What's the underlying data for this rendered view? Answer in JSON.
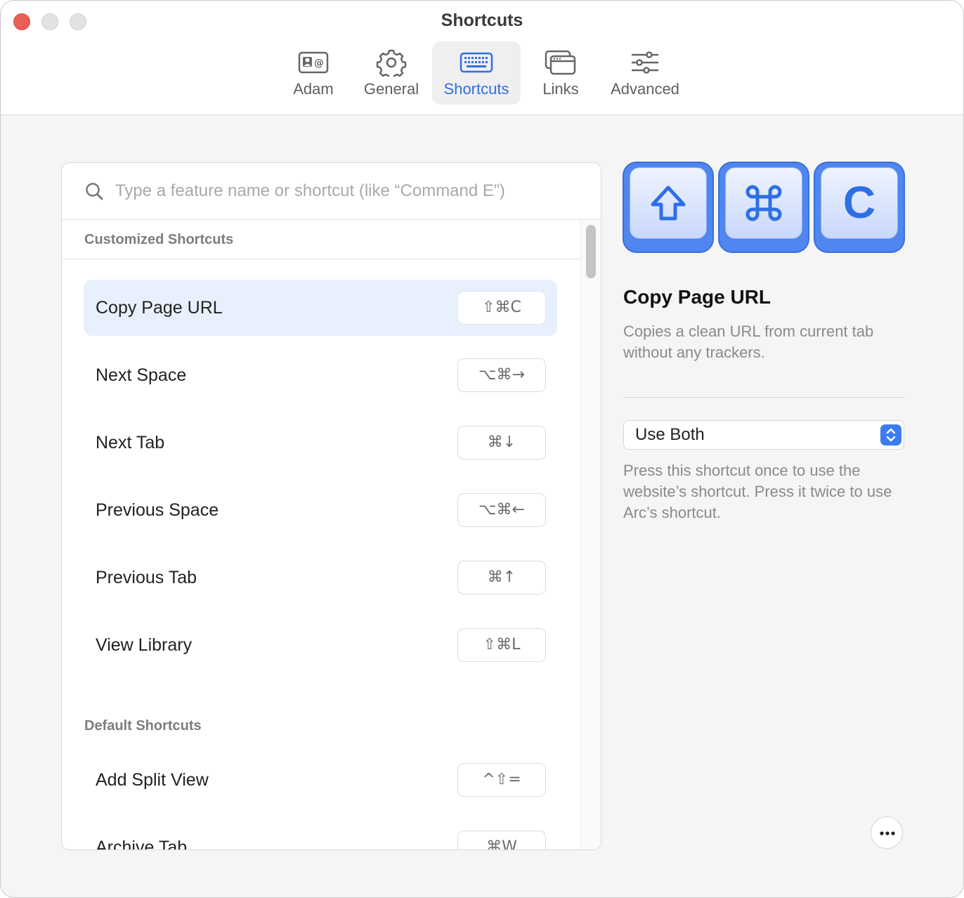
{
  "window": {
    "title": "Shortcuts"
  },
  "tabs": [
    {
      "label": "Adam",
      "icon": "contact-card-icon"
    },
    {
      "label": "General",
      "icon": "gear-icon"
    },
    {
      "label": "Shortcuts",
      "icon": "keyboard-icon",
      "selected": true
    },
    {
      "label": "Links",
      "icon": "browser-windows-icon"
    },
    {
      "label": "Advanced",
      "icon": "sliders-icon"
    }
  ],
  "search": {
    "placeholder": "Type a feature name or shortcut (like “Command E”)",
    "value": ""
  },
  "sections": {
    "customized": {
      "title": "Customized Shortcuts",
      "items": [
        {
          "name": "Copy Page URL",
          "keys": "⇧⌘C",
          "selected": true
        },
        {
          "name": "Next Space",
          "keys": "⌥⌘→"
        },
        {
          "name": "Next Tab",
          "keys": "⌘↓"
        },
        {
          "name": "Previous Space",
          "keys": "⌥⌘←"
        },
        {
          "name": "Previous Tab",
          "keys": "⌘↑"
        },
        {
          "name": "View Library",
          "keys": "⇧⌘L"
        }
      ]
    },
    "default": {
      "title": "Default Shortcuts",
      "items": [
        {
          "name": "Add Split View",
          "keys": "^⇧="
        },
        {
          "name": "Archive Tab",
          "keys": "⌘W"
        }
      ]
    }
  },
  "detail": {
    "keycaps": [
      "shift-key-icon",
      "command-key-icon",
      "C"
    ],
    "title": "Copy Page URL",
    "description": "Copies a clean URL from current tab without any trackers.",
    "select": {
      "value": "Use Both"
    },
    "help": "Press this shortcut once to use the website’s shortcut. Press it twice to use Arc’s shortcut."
  },
  "colors": {
    "accent": "#2f6fe0",
    "keycap": "#4f86f0",
    "selected_row": "#e9f0fd",
    "close": "#ec5f57"
  }
}
